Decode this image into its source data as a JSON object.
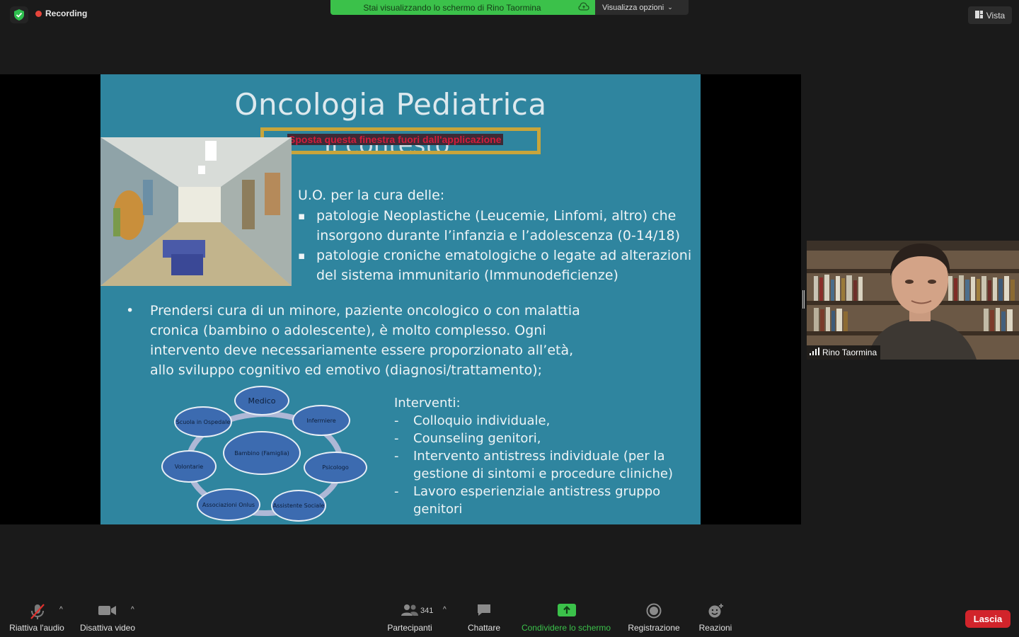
{
  "top": {
    "recording_label": "Recording",
    "share_banner": "Stai visualizzando lo schermo di Rino Taormina",
    "view_options_label": "Visualizza opzioni",
    "view_button_label": "Vista"
  },
  "slide": {
    "title": "Oncologia Pediatrica",
    "subtitle": "Il contesto",
    "move_window_notice": "Sposta questa finestra fuori dall'applicazione",
    "uo_intro": "U.O. per la cura  delle:",
    "uo_items": [
      "patologie Neoplastiche (Leucemie, Linfomi, altro) che insorgono durante l’infanzia  e l’adolescenza (0-14/18)",
      "patologie croniche  ematologiche o legate ad alterazioni del sistema immunitario (Immunodeficienze)"
    ],
    "bullet_char": "•",
    "main_paragraph": "Prendersi cura di un minore, paziente oncologico o con malattia cronica (bambino o adolescente), è molto complesso. Ogni intervento deve necessariamente  essere proporzionato all’età, allo sviluppo cognitivo ed emotivo (diagnosi/trattamento);",
    "interventi_heading": "Interventi:",
    "interventi_items": [
      "Colloquio individuale,",
      "Counseling genitori,",
      "Intervento antistress individuale  (per la gestione di sintomi e procedure cliniche)",
      "Lavoro esperienziale antistress gruppo genitori"
    ],
    "diagram": {
      "center": "Bambino (Famiglia)",
      "nodes": [
        "Medico",
        "Infermiere",
        "Psicologo",
        "Assistente Sociale",
        "Associazioni Onlus",
        "Volontarie",
        "Scuola in Ospedale"
      ]
    }
  },
  "participant": {
    "name": "Rino Taormina"
  },
  "toolbar": {
    "audio_label": "Riattiva l'audio",
    "video_label": "Disattiva video",
    "participants_label": "Partecipanti",
    "participants_count": "341",
    "chat_label": "Chattare",
    "share_label": "Condividere lo schermo",
    "record_label": "Registrazione",
    "reactions_label": "Reazioni",
    "leave_label": "Lascia"
  },
  "colors": {
    "slide_bg": "#2f859f",
    "share_green": "#3bc14a",
    "leave_red": "#d1242b",
    "node_blue": "#3c6bb0"
  }
}
